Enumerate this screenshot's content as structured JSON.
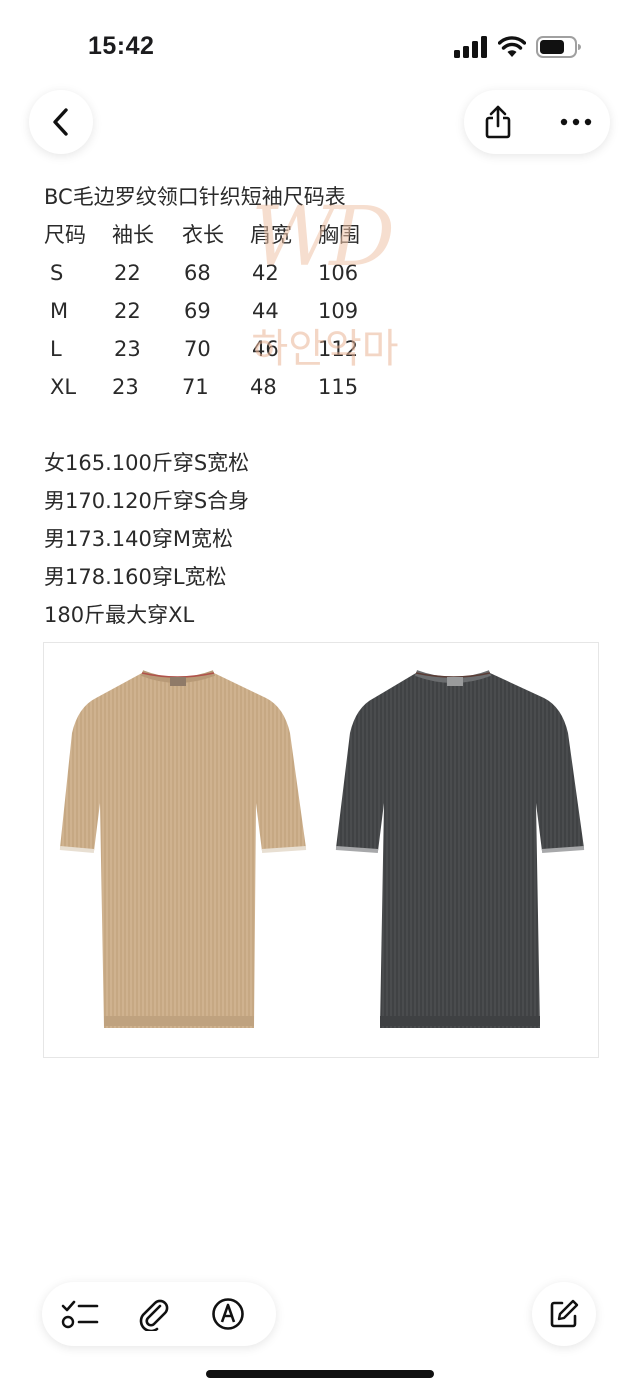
{
  "status_bar": {
    "time": "15:42"
  },
  "nav": {
    "back_icon": "chevron-left-icon",
    "share_icon": "share-icon",
    "more_icon": "ellipsis-icon"
  },
  "note": {
    "title": "BC毛边罗纹领口针织短袖尺码表",
    "table": {
      "headers": [
        "尺码",
        "袖长",
        "衣长",
        "肩宽",
        "胸围"
      ],
      "rows": [
        [
          "S",
          "22",
          "68",
          "42",
          "106"
        ],
        [
          "M",
          "22",
          "69",
          "44",
          "109"
        ],
        [
          "L",
          "23",
          "70",
          "46",
          "112"
        ],
        [
          "XL",
          "23",
          "71",
          "48",
          "115"
        ]
      ]
    },
    "fit_notes": [
      "女165.100斤穿S宽松",
      "男170.120斤穿S合身",
      "男173.140穿M宽松",
      "男178.160穿L宽松",
      "180斤最大穿XL"
    ]
  },
  "watermark": {
    "logo": "WD",
    "text": "하안악마"
  },
  "product_image": {
    "items": [
      {
        "color_name": "beige",
        "color": "#cfb28f"
      },
      {
        "color_name": "dark-grey",
        "color": "#4a4c4e"
      }
    ]
  },
  "toolbar": {
    "checklist_icon": "checklist-icon",
    "attachment_icon": "paperclip-icon",
    "markup_icon": "pen-circle-icon",
    "compose_icon": "compose-icon"
  }
}
